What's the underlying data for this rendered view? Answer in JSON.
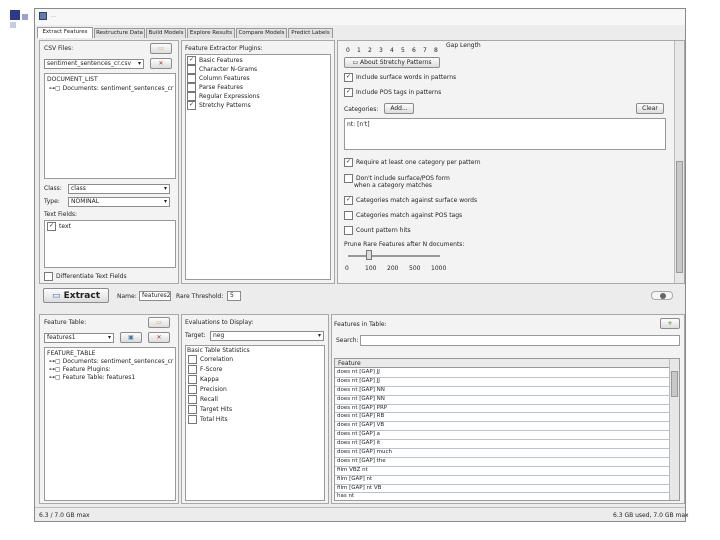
{
  "slide": {
    "bullet_colors": [
      "#2b3a8c",
      "#9aa3c8",
      "#c7cce3"
    ]
  },
  "window": {
    "title": "..."
  },
  "tabs": [
    "Extract Features",
    "Restructure Data",
    "Build Models",
    "Explore Results",
    "Compare Models",
    "Predict Labels"
  ],
  "csv": {
    "label": "CSV Files:",
    "file_combo": "sentiment_sentences_cr.csv",
    "tree_root": "DOCUMENT_LIST",
    "tree_item": "Documents: sentiment_sentences_cr",
    "class_label": "Class:",
    "class_value": "class",
    "type_label": "Type:",
    "type_value": "NOMINAL",
    "text_fields_label": "Text Fields:",
    "text_field": "text",
    "differentiate_label": "Differentiate Text Fields"
  },
  "plugins": {
    "label": "Feature Extractor Plugins:",
    "items": [
      {
        "label": "Basic Features",
        "checked": true
      },
      {
        "label": "Character N-Grams",
        "checked": false
      },
      {
        "label": "Column Features",
        "checked": false
      },
      {
        "label": "Parse Features",
        "checked": false
      },
      {
        "label": "Regular Expressions",
        "checked": false
      },
      {
        "label": "Stretchy Patterns",
        "checked": true
      }
    ]
  },
  "gap": {
    "label": "Gap Length",
    "ticks": [
      "0",
      "1",
      "2",
      "3",
      "4",
      "5",
      "6",
      "7",
      "8"
    ]
  },
  "stretchy": {
    "about_button": "About Stretchy Patterns",
    "surface_words": "Include surface words in patterns",
    "pos_tags": "Include POS tags in patterns",
    "categories_label": "Categories:",
    "add_button": "Add...",
    "clear_button": "Clear",
    "category_text": "nt: [n't]",
    "require_category": "Require at least one category per pattern",
    "dont_include": "Don't include surface/POS form",
    "dont_include_2": "when a category matches",
    "match_surface": "Categories match against surface words",
    "match_pos": "Categories match against POS tags",
    "count_hits": "Count pattern hits",
    "prune_label": "Prune Rare Features after N documents:",
    "slider_ticks": [
      "0",
      "100",
      "200",
      "500",
      "1000"
    ],
    "slider_value": 0.08
  },
  "extract": {
    "button": "Extract",
    "name_label": "Name:",
    "name_value": "features2",
    "threshold_label": "Rare Threshold:",
    "threshold_value": "5"
  },
  "feature_table": {
    "label": "Feature Table:",
    "combo": "features1",
    "tree_root": "FEATURE_TABLE",
    "tree_items": [
      "Documents: sentiment_sentences_cr",
      "Feature Plugins:",
      "Feature Table: features1"
    ]
  },
  "evaluations": {
    "label": "Evaluations to Display:",
    "target_label": "Target:",
    "target_value": "neg",
    "header": "Basic Table Statistics",
    "items": [
      "Correlation",
      "F-Score",
      "Kappa",
      "Precision",
      "Recall",
      "Target Hits",
      "Total Hits"
    ]
  },
  "features_in_table": {
    "label": "Features in Table:",
    "search_label": "Search:",
    "column_header": "Feature",
    "rows": [
      "does nt [GAP] JJ",
      "does nt [GAP] JJ",
      "does nt [GAP] NN",
      "does nt [GAP] NN",
      "does nt [GAP] PRP",
      "does nt [GAP] RB",
      "does nt [GAP] VB",
      "does nt [GAP] a",
      "does nt [GAP] it",
      "does nt [GAP] much",
      "does nt [GAP] the",
      "film VBZ nt",
      "film [GAP] nt",
      "film [GAP] nt VB",
      "has nt",
      "have nt",
      "have nt VBN",
      "have nt [GAP] IN"
    ]
  },
  "status": {
    "left": "6.3 / 7.0 GB max",
    "right": "6.3 GB used, 7.0 GB max"
  }
}
